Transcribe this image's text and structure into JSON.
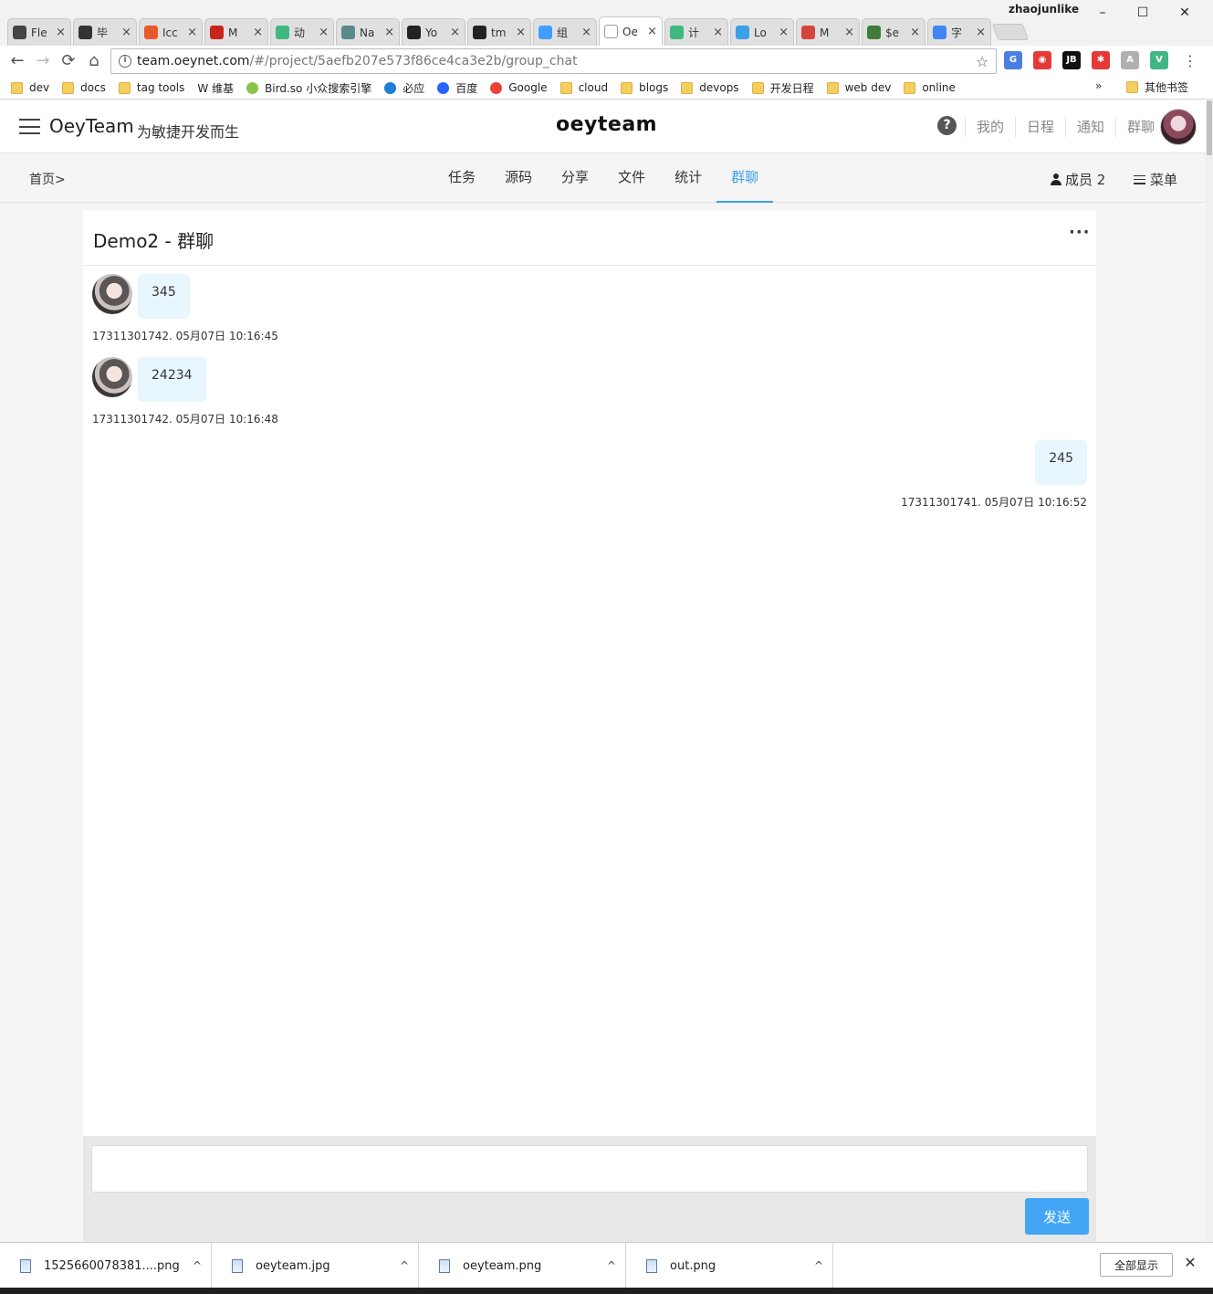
{
  "browser": {
    "profile_name": "zhaojunlike",
    "window_controls": {
      "minimize": "–",
      "maximize": "☐",
      "close": "✕"
    },
    "tabs": [
      {
        "label": "Fle",
        "favicon": "book-icon",
        "color": "#444444"
      },
      {
        "label": "毕",
        "favicon": "t-icon",
        "color": "#333333"
      },
      {
        "label": "Icc",
        "favicon": "icon-font-icon",
        "color": "#e85a2b"
      },
      {
        "label": "M",
        "favicon": "c-icon",
        "color": "#c9251d"
      },
      {
        "label": "动",
        "favicon": "vue-icon",
        "color": "#41b883"
      },
      {
        "label": "Na",
        "favicon": "vue-icon",
        "color": "#5b8a8a"
      },
      {
        "label": "Yo",
        "favicon": "github-icon",
        "color": "#222222"
      },
      {
        "label": "tm",
        "favicon": "github-icon",
        "color": "#222222"
      },
      {
        "label": "组",
        "favicon": "element-icon",
        "color": "#409eff"
      },
      {
        "label": "Oe",
        "favicon": "g-icon",
        "color": "#ffffff",
        "active": true
      },
      {
        "label": "计",
        "favicon": "vue-icon",
        "color": "#41b883"
      },
      {
        "label": "Lo",
        "favicon": "underscore-icon",
        "color": "#3aa0e8"
      },
      {
        "label": "M",
        "favicon": "m-icon",
        "color": "#d6453d"
      },
      {
        "label": "$e",
        "favicon": "mongo-icon",
        "color": "#3f7e3a"
      },
      {
        "label": "字",
        "favicon": "google-icon",
        "color": "#4285f4"
      }
    ],
    "nav": {
      "back": "←",
      "forward": "→",
      "reload": "⟳",
      "home": "⌂"
    },
    "url_host": "team.oeynet.com",
    "url_path": "/#/project/5aefb207e573f86ce4ca3e2b/group_chat",
    "star": "☆",
    "extensions": [
      {
        "name": "translate-icon",
        "color": "#4a7ee0",
        "glyph": "G"
      },
      {
        "name": "red-circle-icon",
        "color": "#e53935",
        "glyph": "◉"
      },
      {
        "name": "jetbrains-icon",
        "color": "#111111",
        "glyph": "JB"
      },
      {
        "name": "red-puzzle-icon",
        "color": "#e53935",
        "glyph": "✱"
      },
      {
        "name": "angular-icon",
        "color": "#b0b0b0",
        "glyph": "A"
      },
      {
        "name": "vue-devtools-icon",
        "color": "#41b883",
        "glyph": "V"
      }
    ],
    "menu": "⋮",
    "bookmarks": [
      {
        "label": "dev",
        "kind": "folder"
      },
      {
        "label": "docs",
        "kind": "folder"
      },
      {
        "label": "tag tools",
        "kind": "folder"
      },
      {
        "label": "W 维基",
        "kind": "plain"
      },
      {
        "label": "Bird.so 小众搜索引擎",
        "kind": "site",
        "color": "#8bc34a"
      },
      {
        "label": "必应",
        "kind": "site",
        "color": "#1c7ed6"
      },
      {
        "label": "百度",
        "kind": "site",
        "color": "#2962ff"
      },
      {
        "label": "Google",
        "kind": "site",
        "color": "#ea4335"
      },
      {
        "label": "cloud",
        "kind": "folder"
      },
      {
        "label": "blogs",
        "kind": "folder"
      },
      {
        "label": "devops",
        "kind": "folder"
      },
      {
        "label": "开发日程",
        "kind": "folder"
      },
      {
        "label": "web dev",
        "kind": "folder"
      },
      {
        "label": "online",
        "kind": "folder"
      }
    ],
    "bookmarks_more": "»",
    "bookmarks_other": "其他书签"
  },
  "app": {
    "brand": "OeyTeam",
    "slogan": "为敏捷开发而生",
    "logo": "oeyteam",
    "help": "?",
    "header_links": [
      "我的",
      "日程",
      "通知",
      "群聊"
    ],
    "breadcrumb": "首页>",
    "tabs": [
      {
        "label": "任务"
      },
      {
        "label": "源码"
      },
      {
        "label": "分享"
      },
      {
        "label": "文件"
      },
      {
        "label": "统计"
      },
      {
        "label": "群聊",
        "active": true
      }
    ],
    "members_label": "成员 2",
    "menu_label": "菜单",
    "accent": "#3aa0e8"
  },
  "chat": {
    "title": "Demo2 - 群聊",
    "more": "···",
    "messages": [
      {
        "side": "left",
        "text": "345",
        "meta": "17311301742. 05月07日 10:16:45"
      },
      {
        "side": "left",
        "text": "24234",
        "meta": "17311301742. 05月07日 10:16:48"
      },
      {
        "side": "right",
        "text": "245",
        "meta": "17311301741. 05月07日 10:16:52"
      }
    ],
    "input_value": "",
    "send_label": "发送",
    "bubble_color": "#e8f6fd",
    "send_color": "#42a5f5"
  },
  "downloads": {
    "items": [
      {
        "name": "1525660078381....png"
      },
      {
        "name": "oeyteam.jpg"
      },
      {
        "name": "oeyteam.png"
      },
      {
        "name": "out.png"
      }
    ],
    "caret": "^",
    "show_all": "全部显示",
    "close": "✕"
  }
}
